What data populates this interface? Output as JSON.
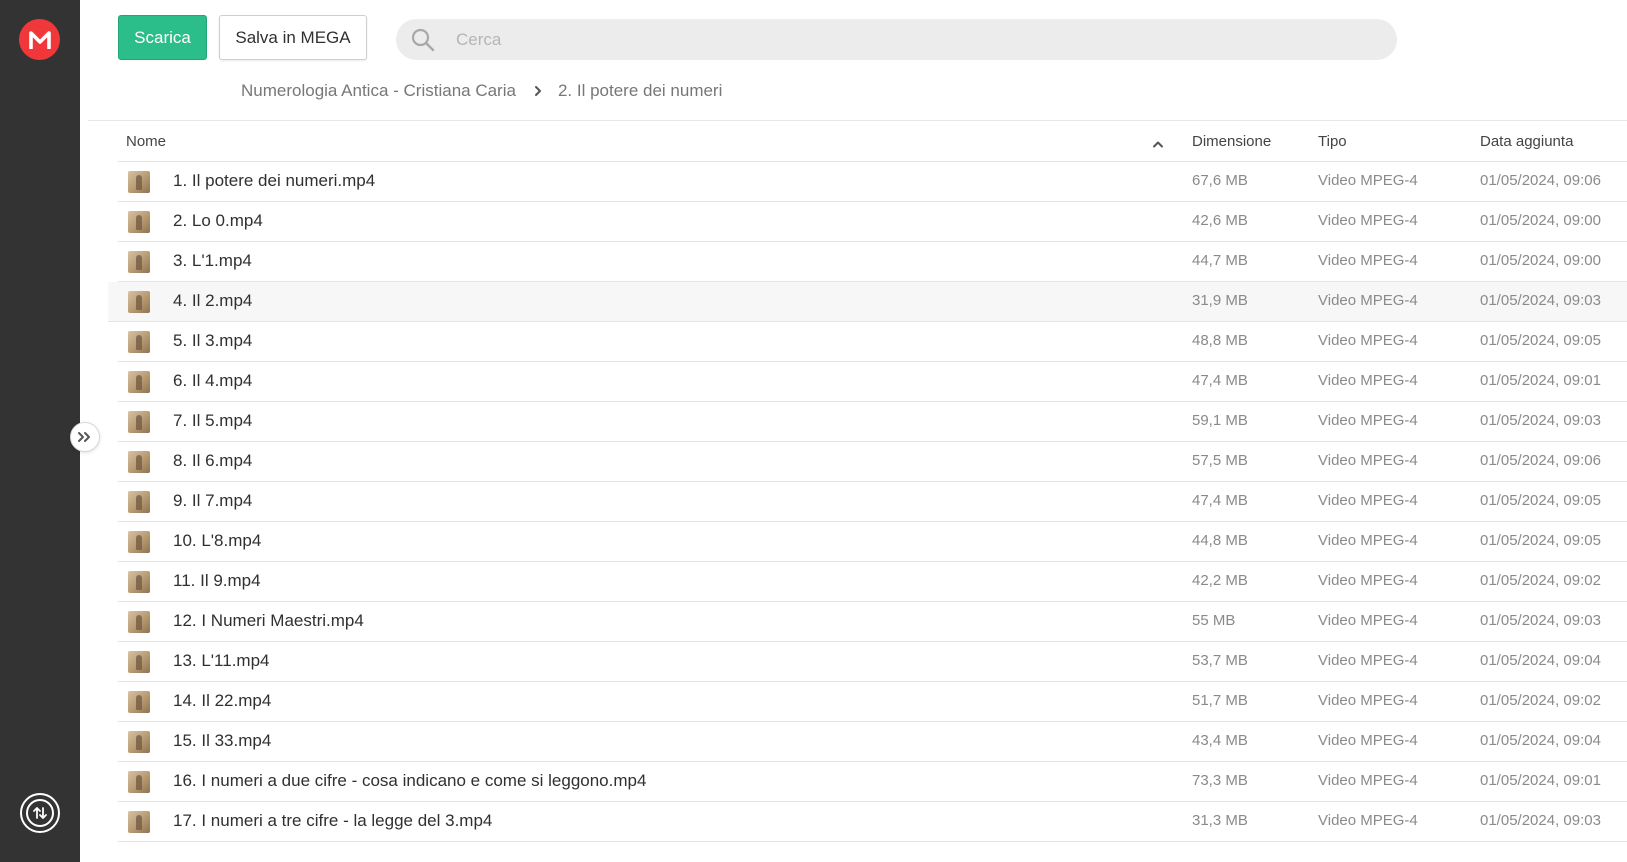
{
  "toolbar": {
    "download_label": "Scarica",
    "save_label": "Salva in MEGA"
  },
  "search": {
    "placeholder": "Cerca"
  },
  "breadcrumb": {
    "items": [
      "Numerologia Antica - Cristiana Caria",
      "2. Il potere dei numeri"
    ]
  },
  "table": {
    "headers": {
      "name": "Nome",
      "size": "Dimensione",
      "type": "Tipo",
      "date": "Data aggiunta"
    },
    "rows": [
      {
        "name": "1. Il potere dei numeri.mp4",
        "size": "67,6 MB",
        "type": "Video MPEG-4",
        "date": "01/05/2024, 09:06"
      },
      {
        "name": "2. Lo 0.mp4",
        "size": "42,6 MB",
        "type": "Video MPEG-4",
        "date": "01/05/2024, 09:00"
      },
      {
        "name": "3. L'1.mp4",
        "size": "44,7 MB",
        "type": "Video MPEG-4",
        "date": "01/05/2024, 09:00"
      },
      {
        "name": "4. Il 2.mp4",
        "size": "31,9 MB",
        "type": "Video MPEG-4",
        "date": "01/05/2024, 09:03"
      },
      {
        "name": "5. Il 3.mp4",
        "size": "48,8 MB",
        "type": "Video MPEG-4",
        "date": "01/05/2024, 09:05"
      },
      {
        "name": "6. Il 4.mp4",
        "size": "47,4 MB",
        "type": "Video MPEG-4",
        "date": "01/05/2024, 09:01"
      },
      {
        "name": "7. Il 5.mp4",
        "size": "59,1 MB",
        "type": "Video MPEG-4",
        "date": "01/05/2024, 09:03"
      },
      {
        "name": "8. Il 6.mp4",
        "size": "57,5 MB",
        "type": "Video MPEG-4",
        "date": "01/05/2024, 09:06"
      },
      {
        "name": "9. Il 7.mp4",
        "size": "47,4 MB",
        "type": "Video MPEG-4",
        "date": "01/05/2024, 09:05"
      },
      {
        "name": "10. L'8.mp4",
        "size": "44,8 MB",
        "type": "Video MPEG-4",
        "date": "01/05/2024, 09:05"
      },
      {
        "name": "11. Il 9.mp4",
        "size": "42,2 MB",
        "type": "Video MPEG-4",
        "date": "01/05/2024, 09:02"
      },
      {
        "name": "12. I Numeri Maestri.mp4",
        "size": "55 MB",
        "type": "Video MPEG-4",
        "date": "01/05/2024, 09:03"
      },
      {
        "name": "13. L'11.mp4",
        "size": "53,7 MB",
        "type": "Video MPEG-4",
        "date": "01/05/2024, 09:04"
      },
      {
        "name": "14. Il 22.mp4",
        "size": "51,7 MB",
        "type": "Video MPEG-4",
        "date": "01/05/2024, 09:02"
      },
      {
        "name": "15. Il 33.mp4",
        "size": "43,4 MB",
        "type": "Video MPEG-4",
        "date": "01/05/2024, 09:04"
      },
      {
        "name": "16. I numeri a due cifre - cosa indicano e come si leggono.mp4",
        "size": "73,3 MB",
        "type": "Video MPEG-4",
        "date": "01/05/2024, 09:01"
      },
      {
        "name": "17. I numeri a tre cifre - la legge del 3.mp4",
        "size": "31,3 MB",
        "type": "Video MPEG-4",
        "date": "01/05/2024, 09:03"
      }
    ]
  },
  "colors": {
    "brand": "#f0373a",
    "accent": "#2bbd8a",
    "sidebar": "#333333"
  },
  "icons": [
    "mega-logo-icon",
    "transfer-manager-icon",
    "expand-sidebar-icon",
    "search-icon",
    "chevron-right-icon",
    "sort-ascending-icon",
    "video-thumbnail-icon"
  ]
}
